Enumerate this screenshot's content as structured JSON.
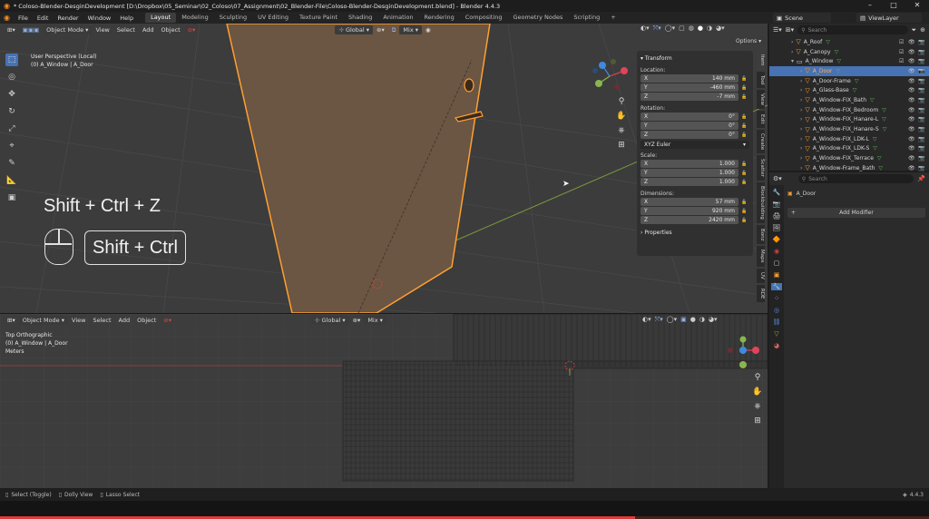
{
  "window": {
    "title": "* Coloso-Blender-DesginDevelopment [D:\\Dropbox\\05_Seminar\\02_Coloso\\07_Assignment\\02_Blender-File\\Coloso-Blender-DesginDevelopment.blend] - Blender 4.4.3",
    "minimize": "–",
    "maximize": "□",
    "close": "✕"
  },
  "menubar": {
    "items": [
      "File",
      "Edit",
      "Render",
      "Window",
      "Help"
    ],
    "workspaces": [
      "Layout",
      "Modeling",
      "Sculpting",
      "UV Editing",
      "Texture Paint",
      "Shading",
      "Animation",
      "Rendering",
      "Compositing",
      "Geometry Nodes",
      "Scripting"
    ],
    "add_tab": "+",
    "scene": "Scene",
    "view_layer": "ViewLayer"
  },
  "viewport_top": {
    "mode": "Object Mode",
    "menus": [
      "View",
      "Select",
      "Add",
      "Object"
    ],
    "transform_orientation": "Global",
    "shading_mix": "Mix",
    "options": "Options",
    "overlay_line1": "User Perspective (Local)",
    "overlay_line2": "(0) A_Window | A_Door",
    "shortcut_text": "Shift + Ctrl + Z",
    "shortcut_key": "Shift + Ctrl"
  },
  "npanel": {
    "section": "Transform",
    "location_label": "Location:",
    "location": [
      {
        "axis": "X",
        "value": "140 mm"
      },
      {
        "axis": "Y",
        "value": "-460 mm"
      },
      {
        "axis": "Z",
        "value": "-7 mm"
      }
    ],
    "rotation_label": "Rotation:",
    "rotation": [
      {
        "axis": "X",
        "value": "0°"
      },
      {
        "axis": "Y",
        "value": "0°"
      },
      {
        "axis": "Z",
        "value": "0°"
      }
    ],
    "rotation_mode": "XYZ Euler",
    "scale_label": "Scale:",
    "scale": [
      {
        "axis": "X",
        "value": "1.000"
      },
      {
        "axis": "Y",
        "value": "1.000"
      },
      {
        "axis": "Z",
        "value": "1.000"
      }
    ],
    "dimensions_label": "Dimensions:",
    "dimensions": [
      {
        "axis": "X",
        "value": "57 mm"
      },
      {
        "axis": "Y",
        "value": "920 mm"
      },
      {
        "axis": "Z",
        "value": "2420 mm"
      }
    ],
    "properties": "Properties",
    "tabs": [
      "Item",
      "Tool",
      "View",
      "Edit",
      "Create",
      "Scatter",
      "Blockbuilding",
      "Bonz",
      "Maps",
      "UV",
      "RDE"
    ]
  },
  "viewport_bottom": {
    "mode": "Object Mode",
    "menus": [
      "View",
      "Select",
      "Add",
      "Object"
    ],
    "transform_orientation": "Global",
    "shading_mix": "Mix",
    "overlay_line1": "Top Orthographic",
    "overlay_line2": "(0) A_Window | A_Door",
    "overlay_line3": "Meters"
  },
  "outliner": {
    "search_placeholder": "Search",
    "rows": [
      {
        "name": "A_Roof",
        "indent": 1,
        "state": "normal"
      },
      {
        "name": "A_Canopy",
        "indent": 1,
        "state": "normal"
      },
      {
        "name": "A_Window",
        "indent": 1,
        "state": "normal"
      },
      {
        "name": "A_Door",
        "indent": 2,
        "state": "active"
      },
      {
        "name": "A_Door-Frame",
        "indent": 2,
        "state": "normal"
      },
      {
        "name": "A_Glass-Base",
        "indent": 2,
        "state": "normal"
      },
      {
        "name": "A_Window-FIX_Bath",
        "indent": 2,
        "state": "normal"
      },
      {
        "name": "A_Window-FIX_Bedroom",
        "indent": 2,
        "state": "normal"
      },
      {
        "name": "A_Window-FIX_Hanare-L",
        "indent": 2,
        "state": "normal"
      },
      {
        "name": "A_Window-FIX_Hanare-S",
        "indent": 2,
        "state": "normal"
      },
      {
        "name": "A_Window-FIX_LDK-L",
        "indent": 2,
        "state": "normal"
      },
      {
        "name": "A_Window-FIX_LDK-S",
        "indent": 2,
        "state": "normal"
      },
      {
        "name": "A_Window-FIX_Terrace",
        "indent": 2,
        "state": "normal"
      },
      {
        "name": "A_Window-Frame_Bath",
        "indent": 2,
        "state": "normal"
      }
    ]
  },
  "properties_panel": {
    "search_placeholder": "Search",
    "object_name": "A_Door",
    "add_modifier": "Add Modifier"
  },
  "statusbar": {
    "items": [
      "Select (Toggle)",
      "Dolly View",
      "Lasso Select"
    ],
    "version": "4.4.3"
  },
  "colors": {
    "accent": "#4772b3",
    "selection_outline": "#ffa030",
    "x_axis": "#e2445a",
    "y_axis": "#8ab64d",
    "z_axis": "#3d8bdf"
  }
}
